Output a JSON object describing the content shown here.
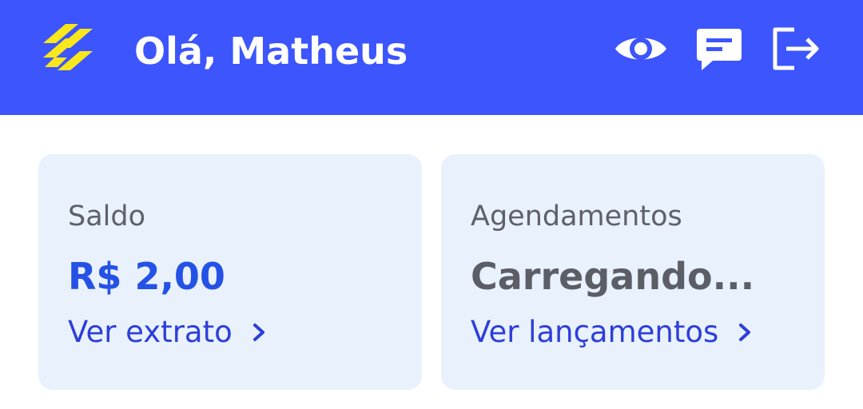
{
  "header": {
    "greeting": "Olá, Matheus",
    "logo_icon": "banco-do-brasil-logo",
    "icons": [
      "eye-icon",
      "chat-icon",
      "logout-icon"
    ],
    "background_color": "#3c55fd",
    "logo_color": "#f8e71c"
  },
  "cards": {
    "balance": {
      "label": "Saldo",
      "value": "R$ 2,00",
      "link": "Ver extrato"
    },
    "schedules": {
      "label": "Agendamentos",
      "value": "Carregando...",
      "link": "Ver lançamentos"
    }
  },
  "colors": {
    "card_background": "#e9f1fd",
    "value_blue": "#2552e6",
    "link_blue": "#2d3ed9",
    "muted_text": "#5f6069"
  }
}
